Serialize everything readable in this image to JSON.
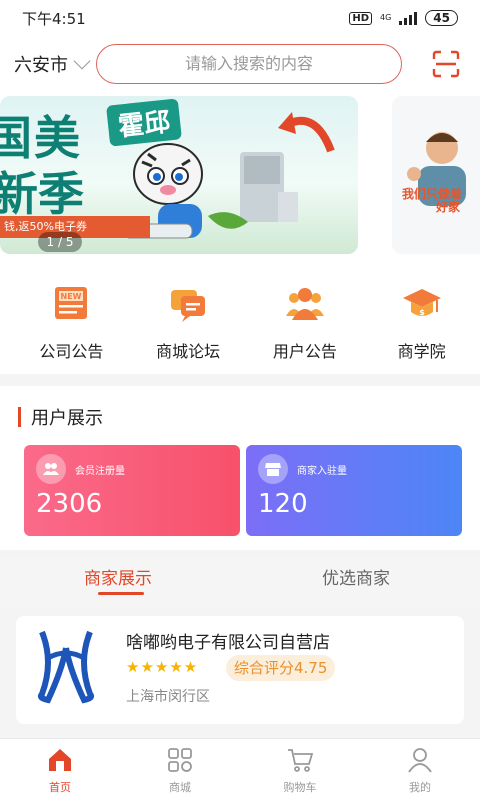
{
  "status_bar": {
    "time": "下午4:51",
    "hd": "HD",
    "network": "4G",
    "battery": "45"
  },
  "header": {
    "city": "六安市",
    "search_placeholder": "请输入搜索的内容"
  },
  "banner": {
    "brand": "霍邱",
    "headline_1": "国美",
    "headline_2": "新季",
    "strip_text": "钱,返50%电子券",
    "pager": "1 / 5",
    "second_slogan_1": "我们只做着",
    "second_slogan_2": "好家"
  },
  "quick_menu": [
    {
      "label": "公司公告",
      "icon": "news-icon"
    },
    {
      "label": "商城论坛",
      "icon": "forum-icon"
    },
    {
      "label": "用户公告",
      "icon": "users-icon"
    },
    {
      "label": "商学院",
      "icon": "graduation-cap-icon"
    }
  ],
  "user_display": {
    "title": "用户展示",
    "cards": [
      {
        "label": "会员注册量",
        "value": "2306",
        "icon": "member-icon",
        "color": "#f7516b"
      },
      {
        "label": "商家入驻量",
        "value": "120",
        "icon": "store-icon",
        "color": "#4d86f6"
      }
    ]
  },
  "merchant_tabs": [
    {
      "label": "商家展示",
      "active": true
    },
    {
      "label": "优选商家",
      "active": false
    }
  ],
  "shop": {
    "name": "啥嘟哟电子有限公司自营店",
    "stars": "★★★★★",
    "score": "综合评分4.75",
    "address": "上海市闵行区"
  },
  "bottom_nav": [
    {
      "label": "首页",
      "icon": "home-icon",
      "active": true
    },
    {
      "label": "商城",
      "icon": "mall-icon",
      "active": false
    },
    {
      "label": "购物车",
      "icon": "cart-icon",
      "active": false
    },
    {
      "label": "我的",
      "icon": "profile-icon",
      "active": false
    }
  ],
  "colors": {
    "accent": "#e2472a",
    "pink_card": "#f7516b",
    "blue_card": "#4d86f6",
    "score": "#e8912d"
  }
}
